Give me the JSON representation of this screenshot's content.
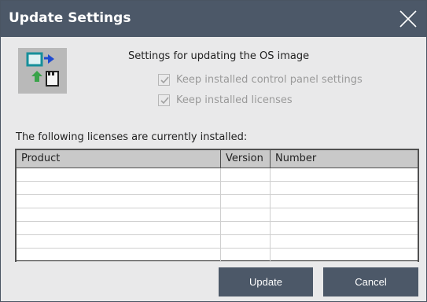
{
  "dialog": {
    "title": "Update Settings",
    "close_icon": "close-icon",
    "settings_heading": "Settings for updating the OS image",
    "options": [
      {
        "label": "Keep installed control panel settings",
        "checked": true,
        "enabled": false
      },
      {
        "label": "Keep installed licenses",
        "checked": true,
        "enabled": false
      }
    ],
    "licenses_label": "The following licenses are currently installed:",
    "table": {
      "columns": [
        "Product",
        "Version",
        "Number"
      ],
      "rows": [
        [
          "",
          "",
          ""
        ],
        [
          "",
          "",
          ""
        ],
        [
          "",
          "",
          ""
        ],
        [
          "",
          "",
          ""
        ],
        [
          "",
          "",
          ""
        ],
        [
          "",
          "",
          ""
        ],
        [
          "",
          "",
          ""
        ]
      ]
    },
    "buttons": {
      "update": "Update",
      "cancel": "Cancel"
    },
    "colors": {
      "titlebar": "#4c5868",
      "background": "#e9e9ea",
      "button": "#4c5868"
    }
  }
}
